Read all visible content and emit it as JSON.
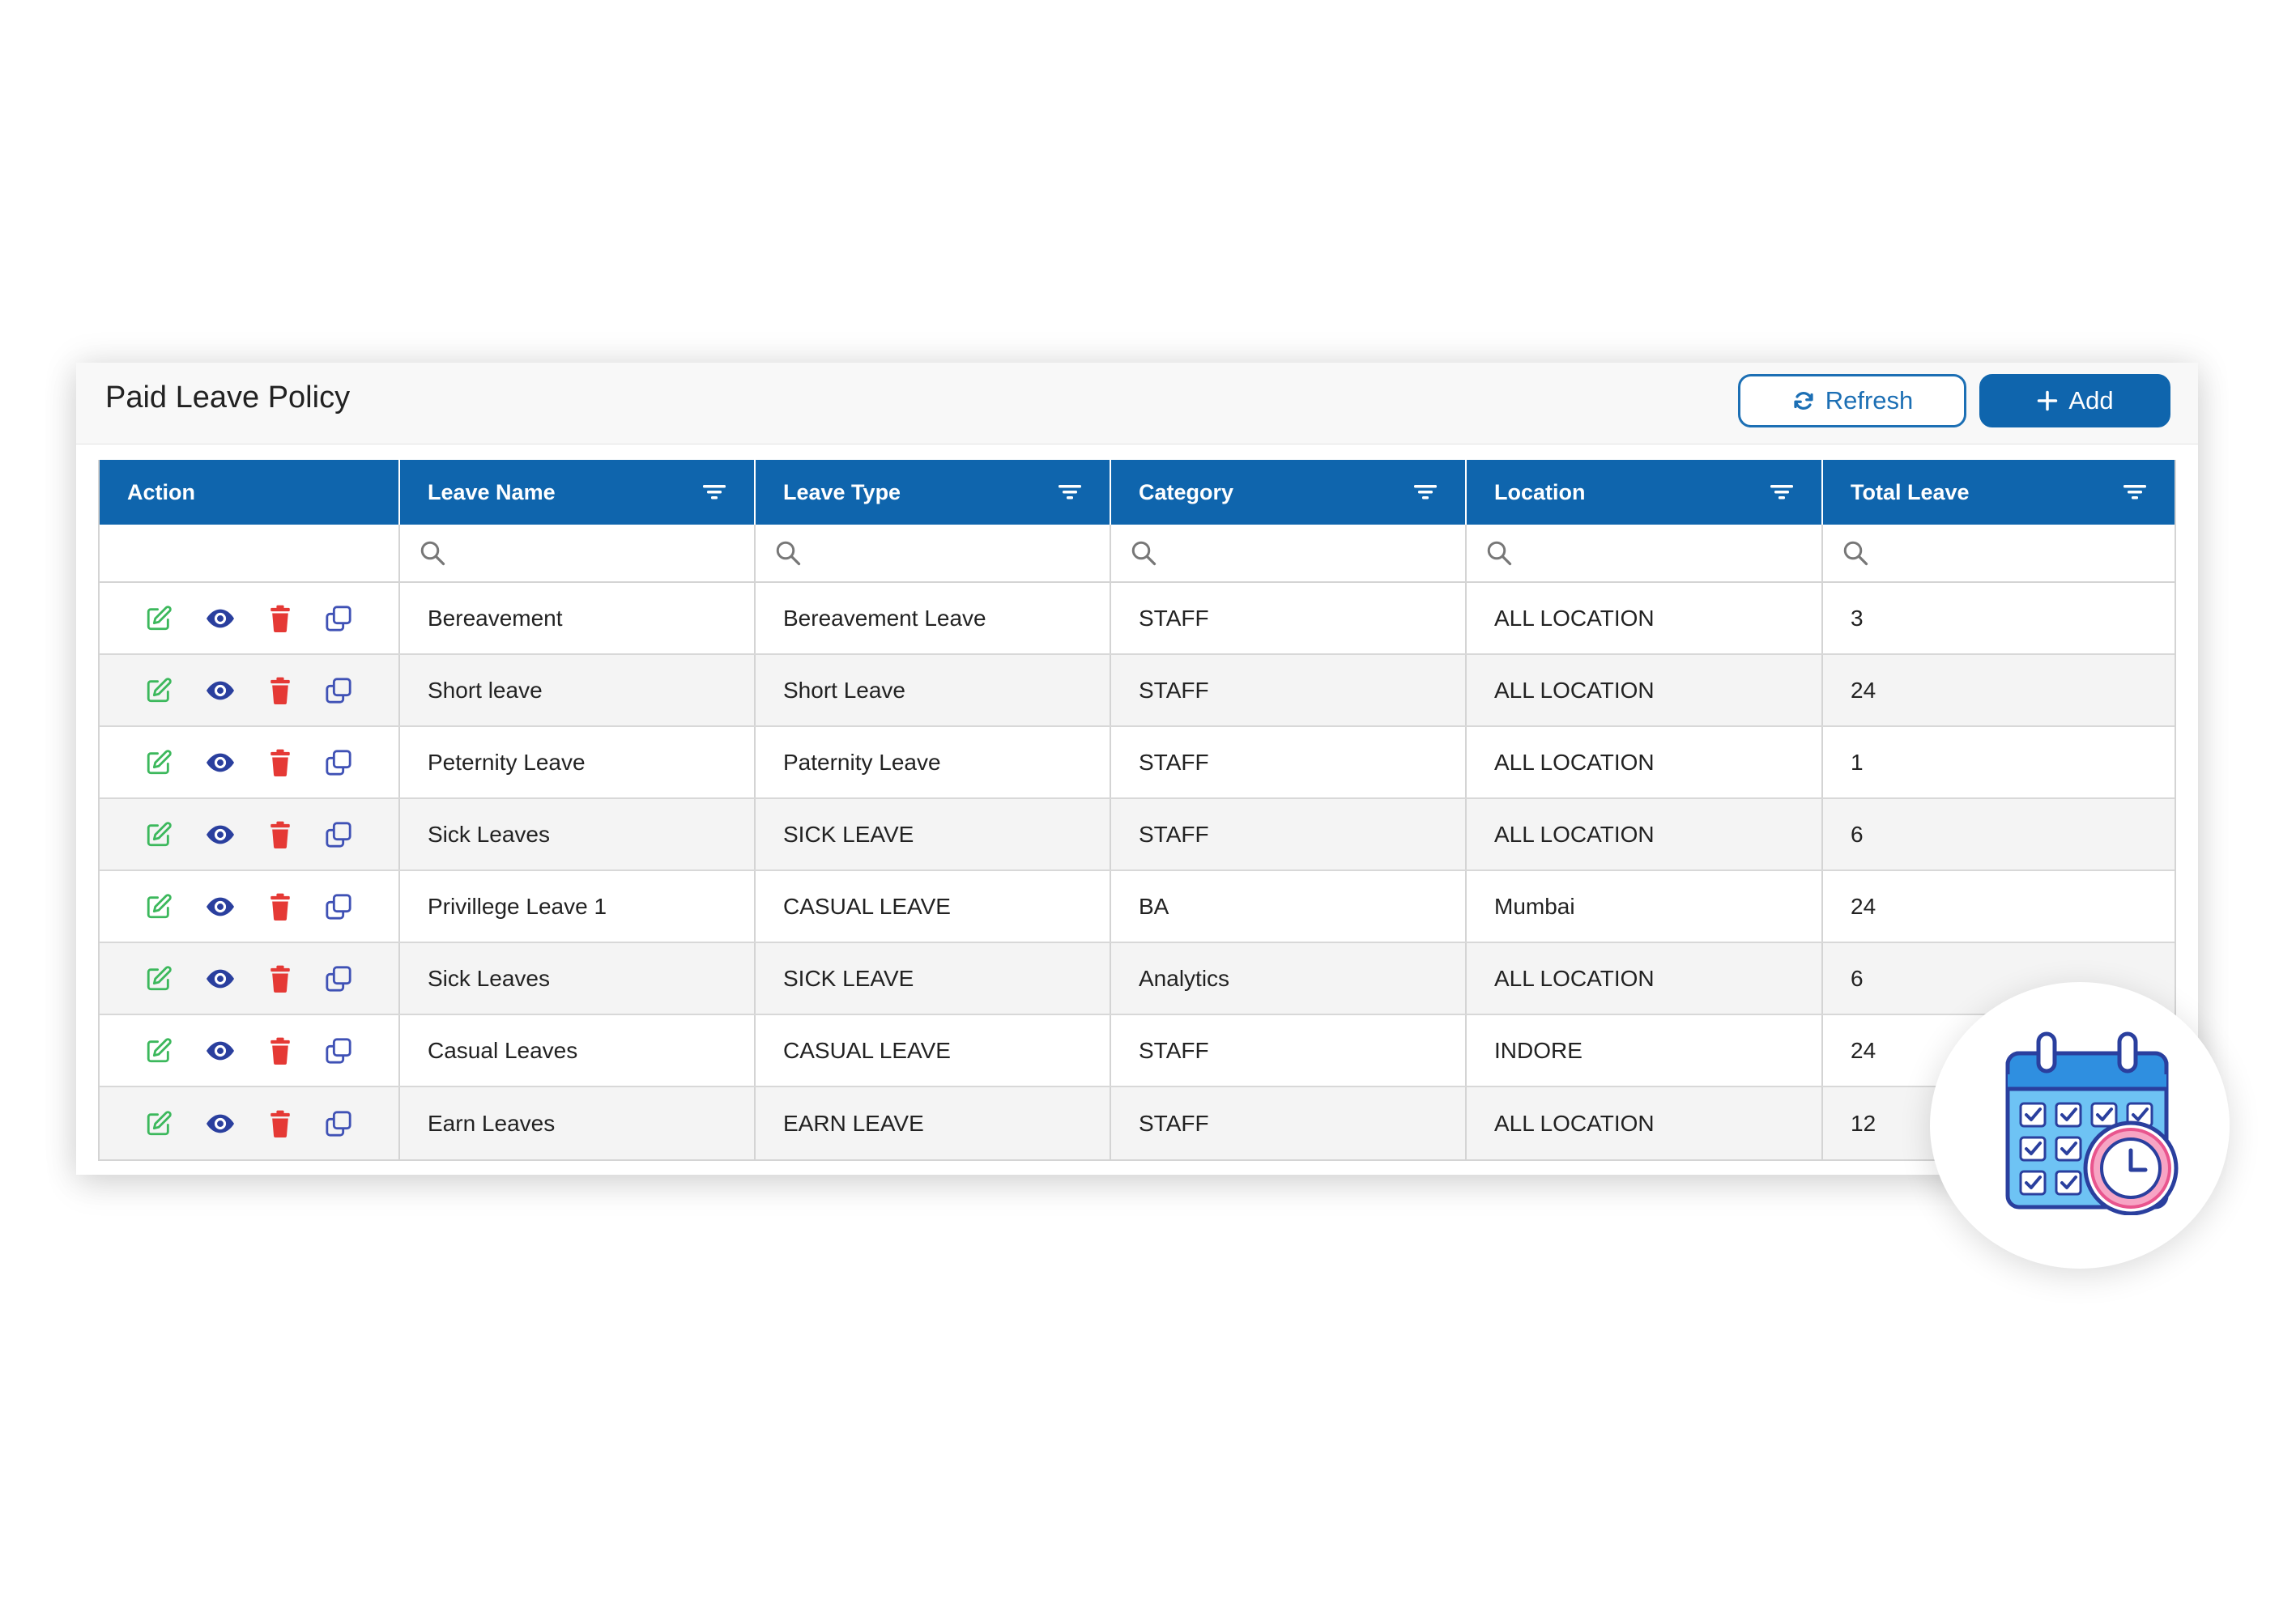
{
  "header": {
    "title": "Paid Leave Policy",
    "refresh_label": "Refresh",
    "add_label": "Add"
  },
  "table": {
    "columns": [
      "Action",
      "Leave Name",
      "Leave Type",
      "Category",
      "Location",
      "Total Leave"
    ],
    "rows": [
      {
        "leave_name": "Bereavement",
        "leave_type": "Bereavement Leave",
        "category": "STAFF",
        "location": "ALL LOCATION",
        "total_leave": "3"
      },
      {
        "leave_name": "Short leave",
        "leave_type": "Short Leave",
        "category": "STAFF",
        "location": "ALL LOCATION",
        "total_leave": "24"
      },
      {
        "leave_name": "Peternity Leave",
        "leave_type": "Paternity Leave",
        "category": "STAFF",
        "location": "ALL LOCATION",
        "total_leave": "1"
      },
      {
        "leave_name": "Sick Leaves",
        "leave_type": "SICK LEAVE",
        "category": "STAFF",
        "location": "ALL LOCATION",
        "total_leave": "6"
      },
      {
        "leave_name": "Privillege Leave 1",
        "leave_type": "CASUAL LEAVE",
        "category": "BA",
        "location": "Mumbai",
        "total_leave": "24"
      },
      {
        "leave_name": "Sick Leaves",
        "leave_type": "SICK LEAVE",
        "category": "Analytics",
        "location": "ALL LOCATION",
        "total_leave": "6"
      },
      {
        "leave_name": "Casual Leaves",
        "leave_type": "CASUAL LEAVE",
        "category": "STAFF",
        "location": "INDORE",
        "total_leave": "24"
      },
      {
        "leave_name": "Earn Leaves",
        "leave_type": "EARN LEAVE",
        "category": "STAFF",
        "location": "ALL LOCATION",
        "total_leave": "12"
      }
    ]
  },
  "icons": {
    "refresh": "refresh-icon",
    "add": "plus-icon",
    "filter": "filter-icon",
    "search": "search-icon",
    "edit": "edit-icon",
    "view": "eye-icon",
    "delete": "trash-icon",
    "copy": "copy-icon",
    "badge": "calendar-clock-icon"
  },
  "colors": {
    "header_blue": "#0f65ad",
    "edit_green": "#3cb85c",
    "view_blue": "#2a3f9e",
    "delete_red": "#e53935",
    "copy_indigo": "#3f51b5"
  }
}
